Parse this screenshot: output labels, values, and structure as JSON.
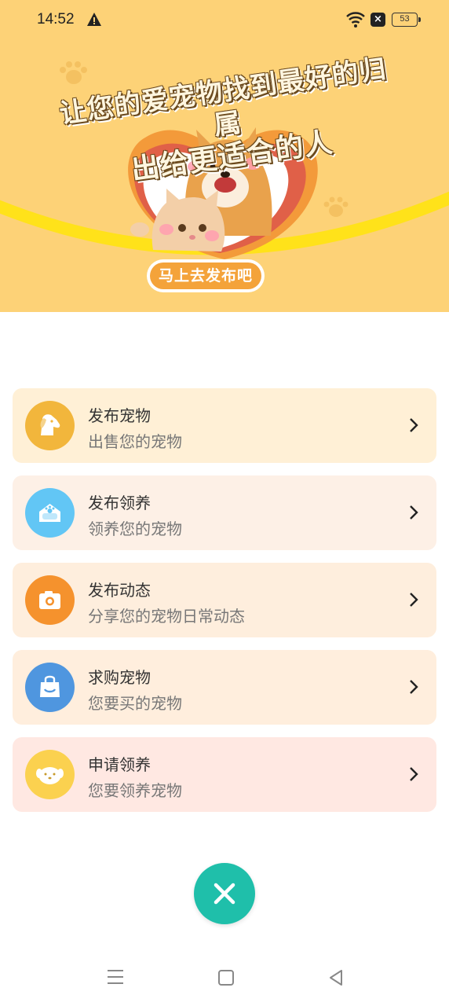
{
  "status_bar": {
    "time": "14:52",
    "battery": "53",
    "icons": [
      "warning-icon",
      "wifi-icon",
      "sim-off-icon",
      "battery-icon"
    ]
  },
  "banner": {
    "title_line1": "让您的爱宠物找到最好的归属",
    "title_line2": "出给更适合的人",
    "button_label": "马上去发布吧",
    "colors": {
      "background": "#fdd277",
      "arc": "#ffe21a",
      "button": "#f4a33a"
    }
  },
  "menu": {
    "items": [
      {
        "title": "发布宠物",
        "subtitle": "出售您的宠物",
        "icon": "dog-icon",
        "bg": "#fff0d6",
        "icon_bg": "#f2b63c"
      },
      {
        "title": "发布领养",
        "subtitle": "领养您的宠物",
        "icon": "pet-house-icon",
        "bg": "#fdf0e6",
        "icon_bg": "#62c6f5"
      },
      {
        "title": "发布动态",
        "subtitle": "分享您的宠物日常动态",
        "icon": "camera-icon",
        "bg": "#feeedd",
        "icon_bg": "#f5922d"
      },
      {
        "title": "求购宠物",
        "subtitle": "您要买的宠物",
        "icon": "shopping-bag-icon",
        "bg": "#ffeedd",
        "icon_bg": "#4f96df"
      },
      {
        "title": "申请领养",
        "subtitle": "您要领养宠物",
        "icon": "puppy-face-icon",
        "bg": "#ffe8e2",
        "icon_bg": "#fbd14f"
      }
    ]
  },
  "close_button": {
    "icon": "close-icon",
    "color": "#1fbfaa"
  },
  "nav_bar": {
    "icons": [
      "menu-icon",
      "home-icon",
      "back-icon"
    ]
  }
}
